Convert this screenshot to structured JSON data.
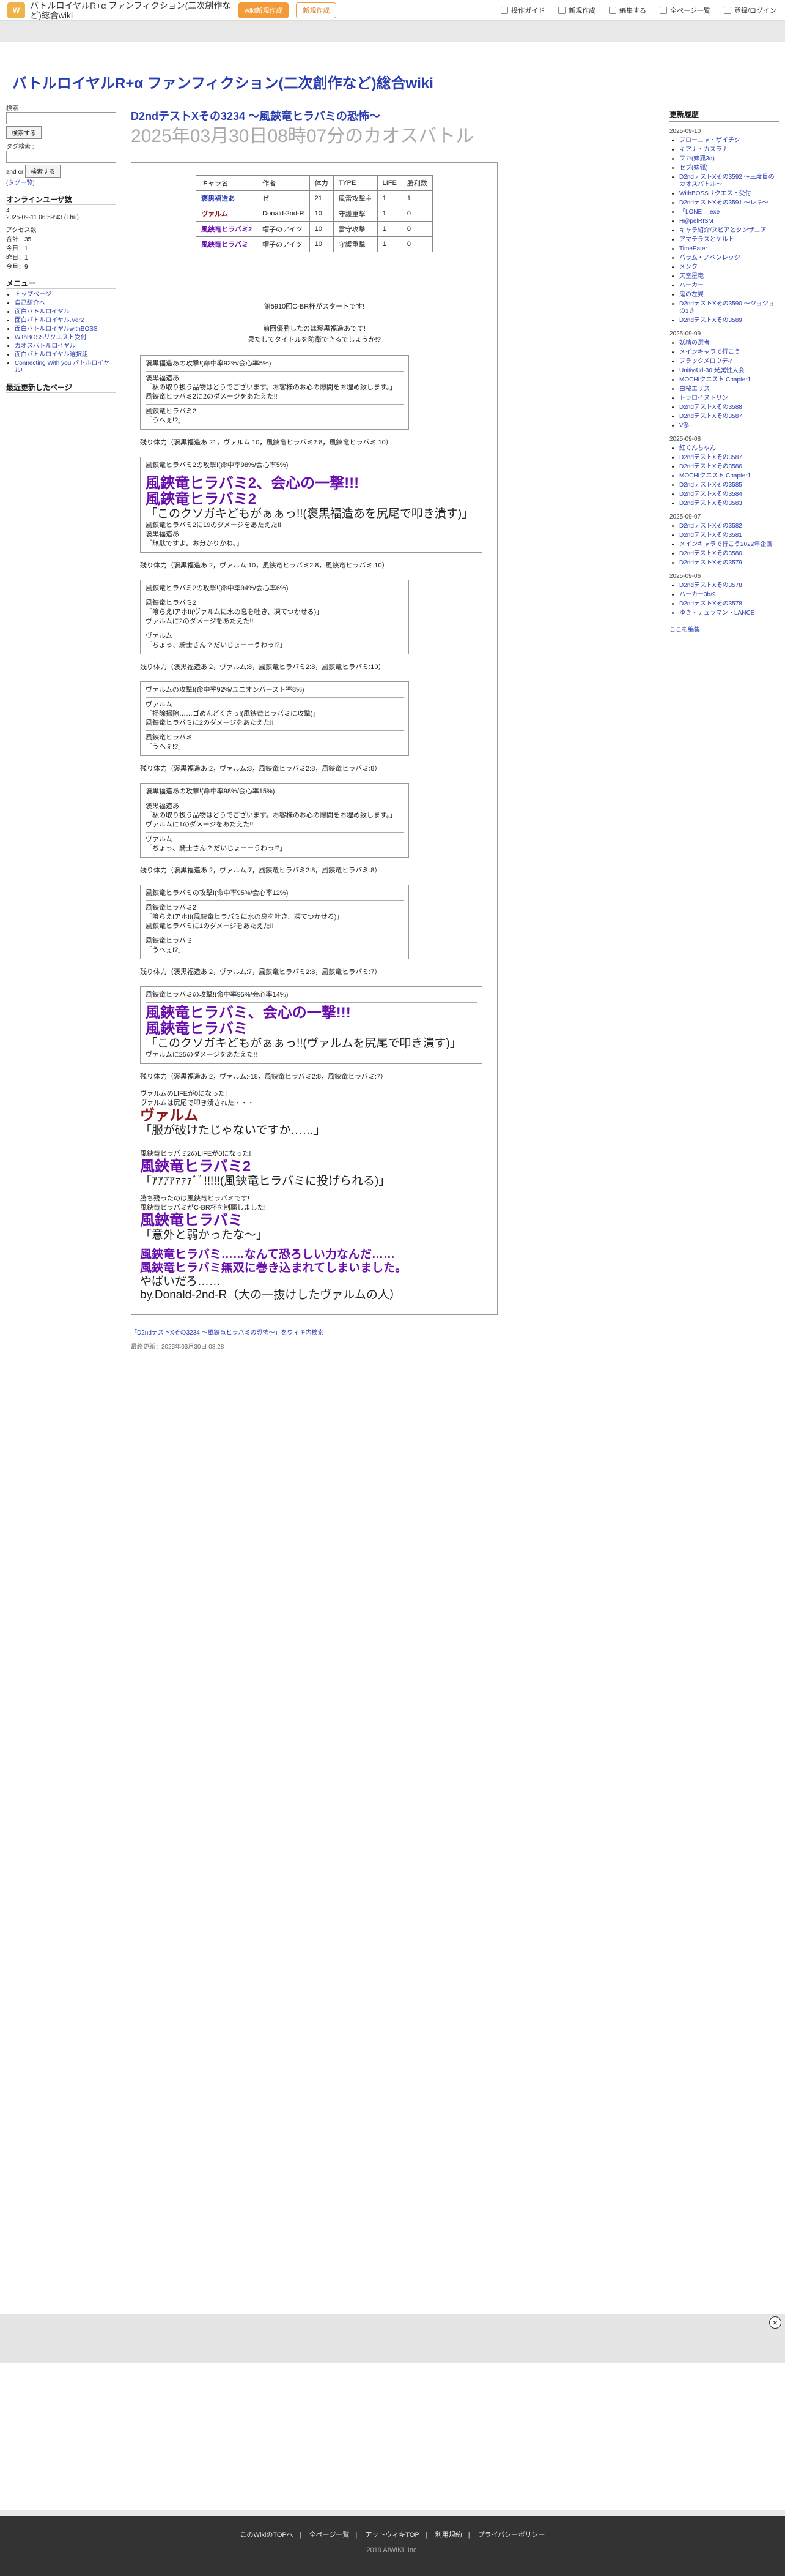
{
  "site_title": "バトルロイヤルR+α ファンフィクション(二次創作など)総合wiki",
  "topbar": {
    "btn1": "wiki新規作成",
    "btn2": "新規作成",
    "nav": [
      "操作ガイド",
      "新規作成",
      "編集する",
      "全ページ一覧",
      "登録/ログイン"
    ]
  },
  "page": {
    "section": "D2ndテストXその3234 〜風鋏竜ヒラバミの恐怖〜",
    "title": "2025年03月30日08時07分のカオスバトル"
  },
  "left": {
    "search_label": "検索 :",
    "search_btn": "検索する",
    "tag_label": "タグ検索 :",
    "and_or": "and  or",
    "tag_btn": "検索する",
    "tags": "(タグ一覧)",
    "online": "オンラインユーザ数",
    "online_num": "4",
    "date": "2025-09-11 06:59:43 (Thu)",
    "access": "アクセス数",
    "today": "合計：35",
    "yest": "今日：1",
    "week": "昨日：1",
    "total": "今月：9",
    "menu_title": "メニュー",
    "menu": [
      "トップページ",
      "自己紹介へ",
      "面白バトルロイヤル",
      "面白バトルロイヤル.Ver2",
      "面白バトルロイヤルwithBOSS",
      "WithBOSSリクエスト受付",
      "カオスバトルロイヤル",
      "面白バトルロイヤル選択組",
      "Connecting With you バトルロイヤル!"
    ],
    "recent_title": "最近更新したページ"
  },
  "characters": {
    "headers": [
      "キャラ名",
      "作者",
      "体力",
      "TYPE",
      "LIFE",
      "勝利数"
    ],
    "rows": [
      [
        "褒黒福造あ",
        "ゼ",
        "21",
        "風雷攻撃主",
        "1",
        "1"
      ],
      [
        "ヴァルム",
        "Donald-2nd-R",
        "10",
        "守護重撃",
        "1",
        "0"
      ],
      [
        "風鋏竜ヒラバミ2",
        "帽子のアイツ",
        "10",
        "雷守攻撃",
        "1",
        "0"
      ],
      [
        "風鋏竜ヒラバミ",
        "帽子のアイツ",
        "10",
        "守護重撃",
        "1",
        "0"
      ]
    ]
  },
  "intro": {
    "l1": "第5910回C-BR杯がスタートです!",
    "l2": "前回優勝したのは褒黒福造あです!",
    "l3": "果たしてタイトルを防衛できるでしょうか!?"
  },
  "log": [
    {
      "type": "box",
      "lines": [
        "褒黒福造あの攻撃!(命中率92%/会心率5%)",
        "褒黒福造あ",
        "「私の取り扱う品物はどうでございます。お客様のお心の隙間をお埋め致します。」",
        "風鋏竜ヒラバミ2に2のダメージをあたえた!!",
        "風鋏竜ヒラバミ2",
        "「うへぇ!?」"
      ]
    },
    {
      "type": "remain",
      "text": "残り体力（褒黒福造あ:21，ヴァルム:10，風鋏竜ヒラバミ2:8，風鋏竜ヒラバミ:10）"
    },
    {
      "type": "bigbox",
      "lines": [
        "風鋏竜ヒラバミ2の攻撃!(命中率98%/会心率5%)",
        "風鋏竜ヒラバミ2、会心の一撃!!!",
        "風鋏竜ヒラバミ2",
        "「このクソガキどもがぁぁっ!!(褒黒福造あを尻尾で叩き潰す)」",
        "風鋏竜ヒラバミ2に19のダメージをあたえた!!",
        "褒黒福造あ",
        "「無駄ですよ。お分かりかね。」"
      ]
    },
    {
      "type": "remain",
      "text": "残り体力（褒黒福造あ:2，ヴァルム:10，風鋏竜ヒラバミ2:8，風鋏竜ヒラバミ:10）"
    },
    {
      "type": "box",
      "lines": [
        "風鋏竜ヒラバミ2の攻撃!(命中率94%/会心率6%)",
        "風鋏竜ヒラバミ2",
        "「喰らえ!アホ!!(ヴァルムに水の息を吐き、凍てつかせる)」",
        "ヴァルムに2のダメージをあたえた!!",
        "ヴァルム",
        "「ちょっ、騎士さん!? だいじょーーうわっ!?」"
      ]
    },
    {
      "type": "remain",
      "text": "残り体力（褒黒福造あ:2，ヴァルム:8，風鋏竜ヒラバミ2:8，風鋏竜ヒラバミ:10）"
    },
    {
      "type": "box",
      "lines": [
        "ヴァルムの攻撃!(命中率92%/ユニオンバースト率8%)",
        "ヴァルム",
        "「掃除掃除……ゴめんどくさっ!(風鋏竜ヒラバミに攻撃)」",
        "風鋏竜ヒラバミに2のダメージをあたえた!!",
        "風鋏竜ヒラバミ",
        "「うへぇ!?」"
      ]
    },
    {
      "type": "remain",
      "text": "残り体力（褒黒福造あ:2，ヴァルム:8，風鋏竜ヒラバミ2:8，風鋏竜ヒラバミ:8）"
    },
    {
      "type": "box",
      "lines": [
        "褒黒福造あの攻撃!(命中率98%/会心率15%)",
        "褒黒福造あ",
        "「私の取り扱う品物はどうでございます。お客様のお心の隙間をお埋め致します。」",
        "ヴァルムに1のダメージをあたえた!!",
        "ヴァルム",
        "「ちょっ、騎士さん!? だいじょーーうわっ!?」"
      ]
    },
    {
      "type": "remain",
      "text": "残り体力（褒黒福造あ:2，ヴァルム:7，風鋏竜ヒラバミ2:8，風鋏竜ヒラバミ:8）"
    },
    {
      "type": "box",
      "lines": [
        "風鋏竜ヒラバミの攻撃!(命中率95%/会心率12%)",
        "風鋏竜ヒラバミ2",
        "「喰らえ!アホ!!(風鋏竜ヒラバミに水の息を吐き、凍てつかせる)」",
        "風鋏竜ヒラバミに1のダメージをあたえた!!",
        "風鋏竜ヒラバミ",
        "「うへぇ!?」"
      ]
    },
    {
      "type": "remain",
      "text": "残り体力（褒黒福造あ:2，ヴァルム:7，風鋏竜ヒラバミ2:8，風鋏竜ヒラバミ:7）"
    },
    {
      "type": "bigbox",
      "lines": [
        "風鋏竜ヒラバミの攻撃!(命中率95%/会心率14%)",
        "風鋏竜ヒラバミ、会心の一撃!!!",
        "風鋏竜ヒラバミ",
        "「このクソガキどもがぁぁっ!!(ヴァルムを尻尾で叩き潰す)」",
        "ヴァルムに25のダメージをあたえた!!"
      ]
    },
    {
      "type": "remain",
      "text": "残り体力（褒黒福造あ:2，ヴァルム:-18，風鋏竜ヒラバミ2:8，風鋏竜ヒラバミ:7）"
    }
  ],
  "defeat1": {
    "l1": "ヴァルムのLIFEが0になった!",
    "l2": "ヴァルムは尻尾で叩き潰された・・・",
    "name": "ヴァルム",
    "quote": "「服が破けたじゃないですか……」"
  },
  "final": {
    "l1": "風鋏竜ヒラバミ2のLIFEが0になった!",
    "name": "風鋏竜ヒラバミ2",
    "quote": "「ｱｱｱｱｧｧｧﾞﾞ!!!!!(風鋏竜ヒラバミに投げられる)」",
    "win1": "勝ち残ったのは風鋏竜ヒラバミです!",
    "win2": "風鋏竜ヒラバミがC-BR杯を制覇しました!",
    "name2": "風鋏竜ヒラバミ",
    "quote2": "「意外と弱かったな～」",
    "end1": "風鋏竜ヒラバミ……なんて恐ろしい力なんだ……",
    "end2": "風鋏竜ヒラバミ無双に巻き込まれてしまいました。",
    "end3": "やばいだろ……",
    "end4": "by.Donald-2nd-R（大の一抜けしたヴァルムの人）"
  },
  "footer_link": "「D2ndテストXその3234 〜風鋏竜ヒラバミの恐怖〜」をウィキ内検索",
  "last_update": "最終更新：2025年03月30日 08:28",
  "right": {
    "title": "更新履歴",
    "groups": [
      {
        "date": "2025-09-10",
        "items": [
          "ブローニャ・ザイチク",
          "キアナ・カスラナ",
          "フカ(妹狐3d)",
          "セブ(妹狐)",
          "D2ndテストXその3592 〜三度目のカオスバトル〜",
          "WithBOSSリクエスト受付",
          "D2ndテストXその3591 〜レキ〜",
          "「LONE」.exe",
          "H@pelRISM",
          "キャラ紹介/ヌビアとタンザニア",
          "アマテラスとケルト",
          "TimeEater",
          "バラム・ノベンレッジ",
          "メンク",
          "天空星竜",
          "ハーカー",
          "鬼の左翼",
          "D2ndテストXその3590 〜ジョジョの1さ",
          "D2ndテストXその3589"
        ]
      },
      {
        "date": "2025-09-09",
        "items": [
          "妖精の選考",
          "メインキャラで行こう",
          "ブラックメロウディ",
          "Unitiy&ld-30 光属性大会",
          "MOCHIクエスト Chapter1",
          "白桜エリス",
          "トラロイヌトリン",
          "D2ndテストXその3588",
          "D2ndテストXその3587",
          "V系"
        ]
      },
      {
        "date": "2025-09-08",
        "items": [
          "紅くんちゃん",
          "D2ndテストXその3587",
          "D2ndテストXその3586",
          "MOCHIクエスト Chapter1",
          "D2ndテストXその3585",
          "D2ndテストXその3584",
          "D2ndテストXその3583"
        ]
      },
      {
        "date": "2025-09-07",
        "items": [
          "D2ndテストXその3582",
          "D2ndテストXその3581",
          "メインキャラで行こう2022年企画",
          "D2ndテストXその3580",
          "D2ndテストXその3579"
        ]
      },
      {
        "date": "2025-09-06",
        "items": [
          "D2ndテストXその3578",
          "ハーカー3b/9",
          "D2ndテストXその3578",
          "ゆき・テュラマン・LANCE"
        ]
      }
    ],
    "more": "ここを編集"
  },
  "footer": {
    "links": [
      "このWikiのTOPへ",
      "全ページ一覧",
      "アットウィキTOP",
      "利用規約",
      "プライバシーポリシー"
    ],
    "copy": "2019 AtWIKI, Inc."
  }
}
